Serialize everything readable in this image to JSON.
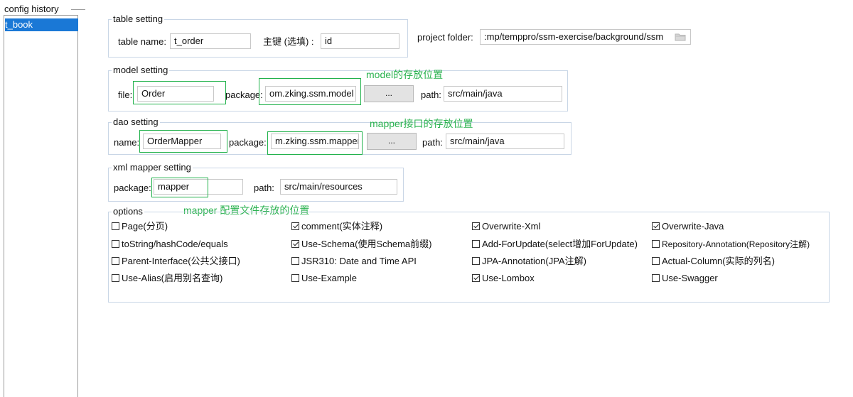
{
  "config_history": {
    "title": "config history",
    "items": [
      "t_book"
    ]
  },
  "table_setting": {
    "title": "table setting",
    "table_name_label": "table  name:",
    "table_name_value": "t_order",
    "pk_label": "主键 (选填) :",
    "pk_value": "id"
  },
  "project_folder": {
    "label": "project folder:",
    "value": ":mp/temppro/ssm-exercise/background/ssm"
  },
  "model_setting": {
    "title": "model setting",
    "file_label": "file:",
    "file_value": "Order",
    "package_label": "package:",
    "package_value": "om.zking.ssm.model",
    "browse_label": "...",
    "path_label": "path:",
    "path_value": "src/main/java",
    "annotation": "model的存放位置"
  },
  "dao_setting": {
    "title": "dao setting",
    "name_label": "name:",
    "name_value": "OrderMapper",
    "package_label": "package:",
    "package_value": "m.zking.ssm.mapper",
    "browse_label": "...",
    "path_label": "path:",
    "path_value": "src/main/java",
    "annotation": "mapper接口的存放位置"
  },
  "xml_setting": {
    "title": "xml mapper setting",
    "package_label": "package:",
    "package_value": "mapper",
    "path_label": "path:",
    "path_value": "src/main/resources",
    "annotation": "mapper 配置文件存放的位置"
  },
  "options": {
    "title": "options",
    "items": [
      {
        "label": "Page(分页)",
        "checked": false
      },
      {
        "label": "comment(实体注释)",
        "checked": true
      },
      {
        "label": "Overwrite-Xml",
        "checked": true
      },
      {
        "label": "Overwrite-Java",
        "checked": true
      },
      {
        "label": "toString/hashCode/equals",
        "checked": false
      },
      {
        "label": "Use-Schema(使用Schema前缀)",
        "checked": true
      },
      {
        "label": "Add-ForUpdate(select增加ForUpdate)",
        "checked": false
      },
      {
        "label": "Repository-Annotation(Repository注解)",
        "checked": false
      },
      {
        "label": "Parent-Interface(公共父接口)",
        "checked": false
      },
      {
        "label": "JSR310: Date and Time API",
        "checked": false
      },
      {
        "label": "JPA-Annotation(JPA注解)",
        "checked": false
      },
      {
        "label": "Actual-Column(实际的列名)",
        "checked": false
      },
      {
        "label": "Use-Alias(启用别名查询)",
        "checked": false
      },
      {
        "label": "Use-Example",
        "checked": false
      },
      {
        "label": "Use-Lombox",
        "checked": true
      },
      {
        "label": "Use-Swagger",
        "checked": false
      }
    ]
  },
  "colors": {
    "selection": "#1a78d6",
    "annotation": "#2ab24f",
    "group_border": "#c9d6e6"
  }
}
